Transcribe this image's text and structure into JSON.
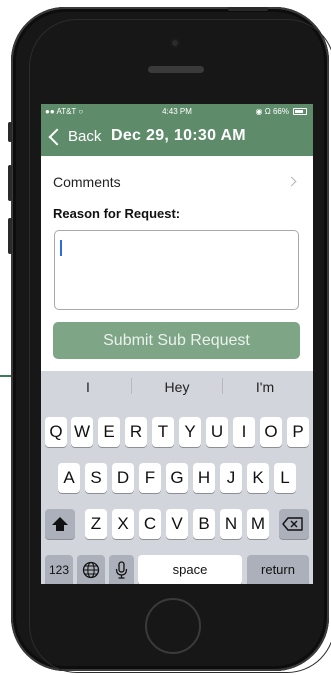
{
  "status_bar": {
    "carrier": "AT&T",
    "time": "4:43 PM",
    "battery": "66%"
  },
  "nav": {
    "back_label": "Back",
    "title": "Dec 29, 10:30 AM"
  },
  "comments_row": {
    "label": "Comments"
  },
  "form": {
    "reason_label": "Reason for Request:",
    "reason_value": "",
    "submit_label": "Submit Sub Request"
  },
  "keyboard": {
    "suggestions": [
      "I",
      "Hey",
      "I'm"
    ],
    "row1": [
      "Q",
      "W",
      "E",
      "R",
      "T",
      "Y",
      "U",
      "I",
      "O",
      "P"
    ],
    "row2": [
      "A",
      "S",
      "D",
      "F",
      "G",
      "H",
      "J",
      "K",
      "L"
    ],
    "row3": [
      "Z",
      "X",
      "C",
      "V",
      "B",
      "N",
      "M"
    ],
    "numbers_key": "123",
    "space_key": "space",
    "return_key": "return",
    "icons": [
      "shift-icon",
      "backspace-icon",
      "globe-icon",
      "microphone-icon"
    ]
  },
  "colors": {
    "brand_green": "#5e8c6b",
    "button_green": "#7ea586"
  }
}
